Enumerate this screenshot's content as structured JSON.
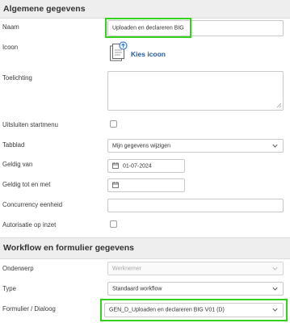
{
  "general": {
    "section_title": "Algemene gegevens",
    "naam": {
      "label": "Naam",
      "value": "Uploaden en declareren BIG"
    },
    "icoon": {
      "label": "Icoon",
      "button_label": "Kies icoon"
    },
    "toelichting": {
      "label": "Toelichting",
      "value": ""
    },
    "uitsluiten": {
      "label": "Uitsluiten startmenu",
      "checked": false
    },
    "tabblad": {
      "label": "Tabblad",
      "value": "Mijn gegevens wijzigen"
    },
    "geldig_van": {
      "label": "Geldig van",
      "value": "01-07-2024"
    },
    "geldig_tot": {
      "label": "Geldig tot en met",
      "value": ""
    },
    "concurrency": {
      "label": "Concurrency eenheid",
      "value": ""
    },
    "autorisatie": {
      "label": "Autorisatie op inzet",
      "checked": false
    }
  },
  "workflow": {
    "section_title": "Workflow en formulier gegevens",
    "onderwerp": {
      "label": "Onderwerp",
      "value": "Werknemer"
    },
    "type": {
      "label": "Type",
      "value": "Standaard workflow"
    },
    "formulier": {
      "label": "Formulier / Dialoog",
      "value": "GEN_D_Uploaden en declareren BIG V01 (D)"
    }
  },
  "colors": {
    "highlight": "#32d21e",
    "link": "#1e5aa8",
    "section_bg": "#eeeeee"
  }
}
